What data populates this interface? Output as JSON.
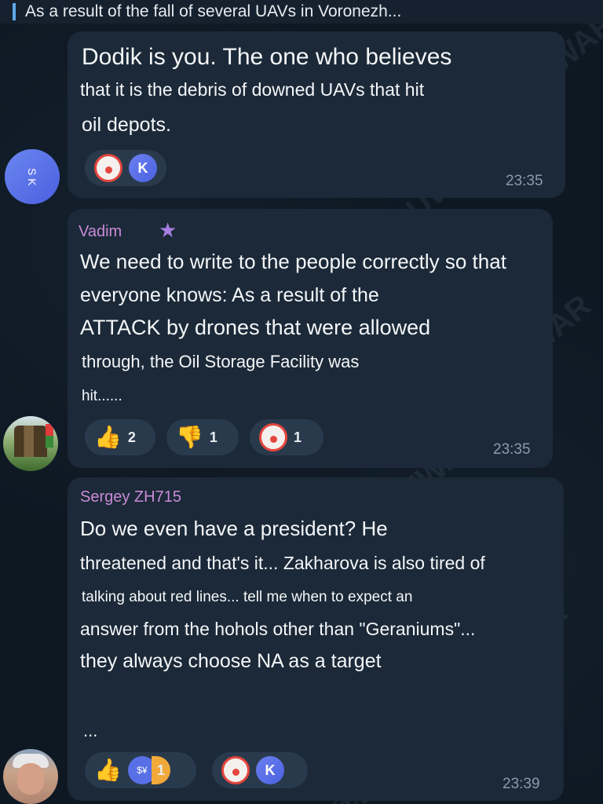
{
  "reply_preview": {
    "text": "As a result of the fall of several UAVs in Voronezh..."
  },
  "watermark": {
    "text": "@ZSUWAR"
  },
  "messages": [
    {
      "lines": [
        "Dodik is you. The one who believes",
        "that it is the debris of downed UAVs that hit",
        "oil depots."
      ],
      "time": "23:35",
      "avatar_text": "S K",
      "reactions": [
        {
          "emoji": "clown-face",
          "badge": "K"
        }
      ]
    },
    {
      "sender": "Vadim",
      "lines": [
        "We need to write to the people correctly so that",
        "everyone knows: As a result of the",
        "ATTACK by drones that were allowed",
        "through, the Oil Storage Facility was",
        "hit......"
      ],
      "time": "23:35",
      "reactions": [
        {
          "emoji": "👍",
          "count": "2"
        },
        {
          "emoji": "👎",
          "count": "1"
        },
        {
          "emoji": "clown-face",
          "count": "1"
        }
      ]
    },
    {
      "sender": "Sergey ZH715",
      "lines": [
        "Do we even have a president? He",
        "threatened and that's it... Zakharova is also tired of",
        "talking about red lines... tell me when to expect an",
        "answer from the hohols other than \"Geraniums\"...",
        "they always choose NA as a target",
        "..."
      ],
      "time": "23:39",
      "reactions": [
        {
          "emoji": "👍",
          "count": "1"
        },
        {
          "emoji": "clown-face",
          "badge": "K"
        }
      ]
    }
  ],
  "colors": {
    "bubble": "#1b2938",
    "sender": "#c98bd6",
    "time": "#8a9bb0",
    "accent": "#5fa8e8"
  }
}
